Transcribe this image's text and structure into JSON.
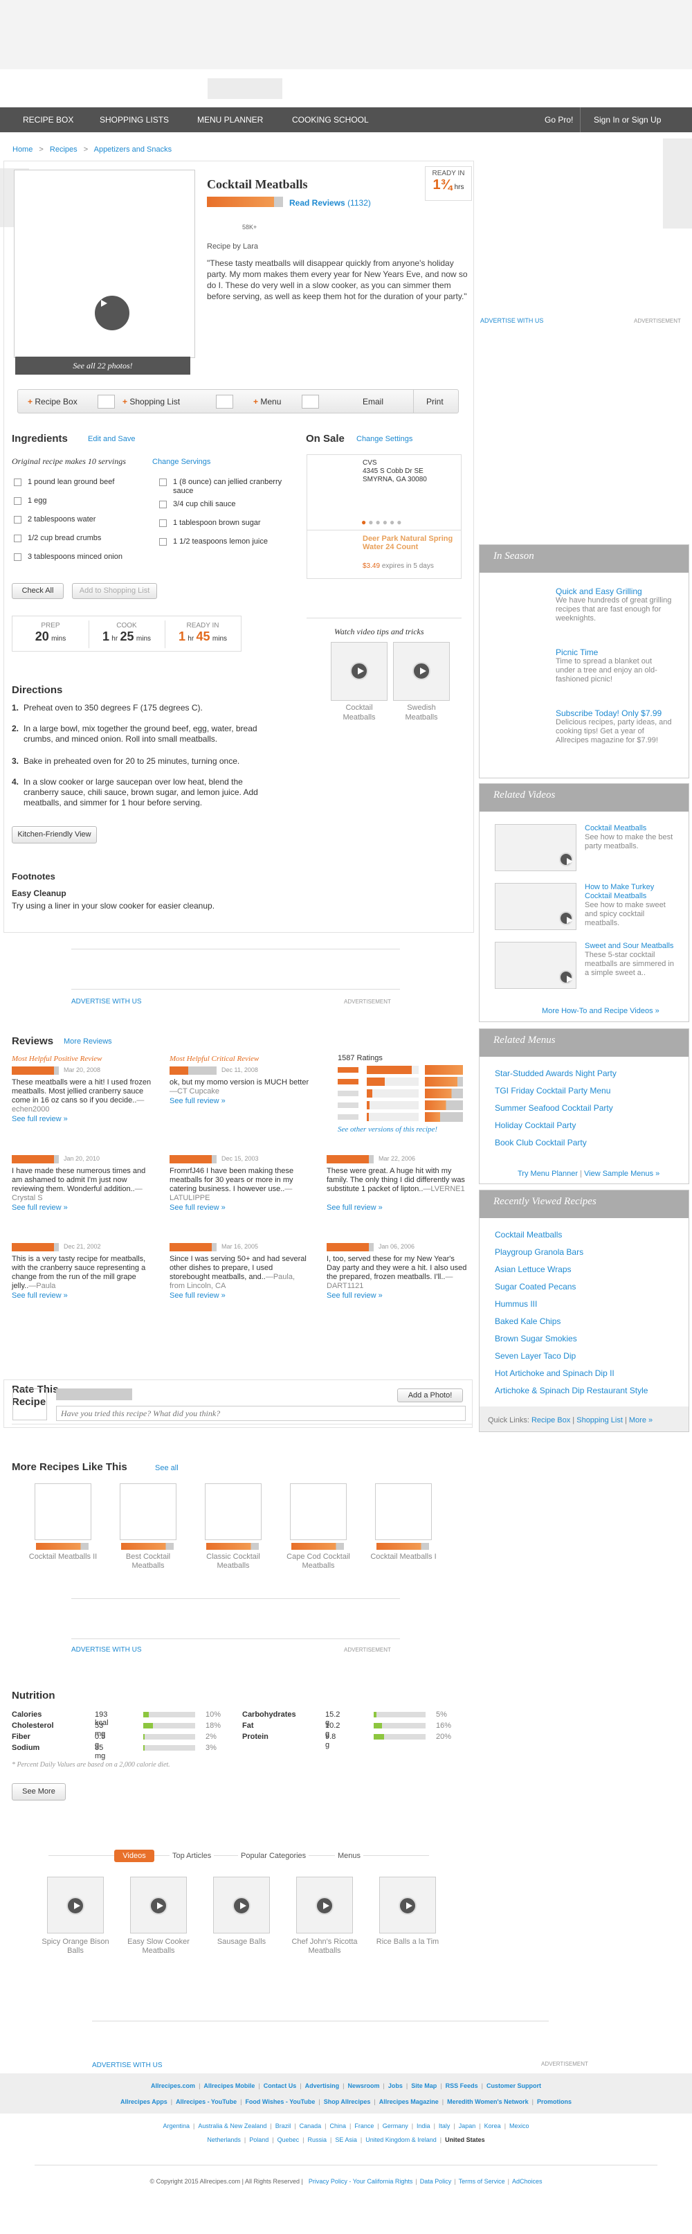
{
  "nav": {
    "items": [
      "RECIPE BOX",
      "SHOPPING LISTS",
      "MENU PLANNER",
      "COOKING SCHOOL"
    ],
    "gopro": "Go Pro!",
    "signin": "Sign In or Sign Up"
  },
  "breadcrumb": [
    "Home",
    "Recipes",
    "Appetizers and Snacks"
  ],
  "recipe": {
    "title": "Cocktail Meatballs",
    "ready_label": "READY IN",
    "ready_value": "1¾",
    "ready_unit": "hrs",
    "reviews_link": "Read Reviews",
    "reviews_count": "(1132)",
    "made_count": "58K+",
    "by": "Recipe by Lara",
    "description": "\"These tasty meatballs will disappear quickly from anyone's holiday party. My mom makes them every year for New Years Eve, and now so do I. These do very well in a slow cooker, as you can simmer them before serving, as well as keep them hot for the duration of your party.\"",
    "photos": "See all 22 photos!",
    "rating_fraction": 0.88
  },
  "actions": [
    "Recipe Box",
    "Shopping List",
    "Menu",
    "Email",
    "Print"
  ],
  "ingredients": {
    "title": "Ingredients",
    "edit": "Edit and Save",
    "servings": "Original recipe makes 10 servings",
    "change": "Change Servings",
    "left": [
      "1 pound lean ground beef",
      "1 egg",
      "2 tablespoons water",
      "1/2 cup bread crumbs",
      "3 tablespoons minced onion"
    ],
    "right": [
      "1 (8 ounce) can jellied cranberry sauce",
      "3/4 cup chili sauce",
      "1 tablespoon brown sugar",
      "1 1/2 teaspoons lemon juice"
    ],
    "check_all": "Check All",
    "add_shop": "Add to Shopping List"
  },
  "times": {
    "prep_label": "PREP",
    "prep": "20",
    "prep_unit": "mins",
    "cook_label": "COOK",
    "cook_h": "1",
    "cook_m": "25",
    "cook_unit_h": "hr",
    "cook_unit_m": "mins",
    "ready_label": "READY IN",
    "ready_h": "1",
    "ready_m": "45",
    "ready_unit_h": "hr",
    "ready_unit_m": "mins"
  },
  "onsale": {
    "title": "On Sale",
    "settings": "Change Settings",
    "store": "CVS",
    "address1": "4345 S Cobb Dr SE",
    "address2": "SMYRNA, GA 30080",
    "product": "Deer Park Natural Spring Water 24 Count",
    "price": "$3.49",
    "expires": "expires in 5 days"
  },
  "videos_tips": {
    "title": "Watch video tips and tricks",
    "items": [
      "Cocktail Meatballs",
      "Swedish Meatballs"
    ]
  },
  "directions": {
    "title": "Directions",
    "steps": [
      "Preheat oven to 350 degrees F (175 degrees C).",
      "In a large bowl, mix together the ground beef, egg, water, bread crumbs, and minced onion. Roll into small meatballs.",
      "Bake in preheated oven for 20 to 25 minutes, turning once.",
      "In a slow cooker or large saucepan over low heat, blend the cranberry sauce, chili sauce, brown sugar, and lemon juice. Add meatballs, and simmer for 1 hour before serving."
    ],
    "kitchen": "Kitchen-Friendly View"
  },
  "footnotes": {
    "title": "Footnotes",
    "sub": "Easy Cleanup",
    "text": "Try using a liner in your slow cooker for easier cleanup."
  },
  "ads": {
    "advertise": "ADVERTISE WITH US",
    "advertisement": "ADVERTISEMENT"
  },
  "reviews": {
    "title": "Reviews",
    "more": "More Reviews",
    "pos_label": "Most Helpful Positive Review",
    "crit_label": "Most Helpful Critical Review",
    "ratings_count": "1587 Ratings",
    "other_versions": "See other versions of this recipe!",
    "full": "See full review »",
    "rating_dist": [
      0.86,
      0.34,
      0.1,
      0.05,
      0.04
    ],
    "items": [
      {
        "date": "Mar 20, 2008",
        "text": "These meatballs were a hit! I used frozen meatballs. Most jellied cranberry sauce come in 16 oz cans so if you decide..",
        "author": "—echen2000",
        "stars": 0.9
      },
      {
        "date": "Dec 11, 2008",
        "text": "ok, but my momo version is MUCH better",
        "author": "—CT Cupcake",
        "stars": 0.4
      },
      {
        "date": "Jan 20, 2010",
        "text": "I have made these numerous times and am ashamed to admit I'm just now reviewing them. Wonderful addition..",
        "author": "—Crystal S",
        "stars": 0.9
      },
      {
        "date": "Dec 15, 2003",
        "text": "FromrfJ46 I have been making these meatballs for 30 years or more in my catering business. I however use..",
        "author": "—LATULIPPE",
        "stars": 0.9
      },
      {
        "date": "Mar 22, 2006",
        "text": "These were great. A huge hit with my family. The only thing I did differently was substitute 1 packet of lipton..",
        "author": "—LVERNE1",
        "stars": 0.9
      },
      {
        "date": "Dec 21, 2002",
        "text": "This is a very tasty recipe for meatballs, with the cranberry sauce representing a change from the run of the mill grape jelly..",
        "author": "—Paula",
        "stars": 0.9
      },
      {
        "date": "Mar 16, 2005",
        "text": "Since I was serving 50+ and had several other dishes to prepare, I used storebought meatballs, and..",
        "author": "—Paula, from Lincoln, CA",
        "stars": 0.9
      },
      {
        "date": "Jan 06, 2006",
        "text": "I, too, served these for my New Year's Day party and they were a hit. I also used the prepared, frozen meatballs. I'll..",
        "author": "—DART1121",
        "stars": 0.9
      }
    ]
  },
  "rate": {
    "title": "Rate This Recipe",
    "add_photo": "Add a Photo!",
    "placeholder": "Have you tried this recipe? What did you think?"
  },
  "more_recipes": {
    "title": "More Recipes Like This",
    "see_all": "See all",
    "items": [
      "Cocktail Meatballs II",
      "Best Cocktail Meatballs",
      "Classic Cocktail Meatballs",
      "Cape Cod Cocktail Meatballs",
      "Cocktail Meatballs I"
    ]
  },
  "nutrition": {
    "title": "Nutrition",
    "left": [
      {
        "name": "Calories",
        "amount": "193 kcal",
        "pct": "10%",
        "v": 0.1
      },
      {
        "name": "Cholesterol",
        "amount": "53 mg",
        "pct": "18%",
        "v": 0.18
      },
      {
        "name": "Fiber",
        "amount": "0.5 g",
        "pct": "2%",
        "v": 0.02
      },
      {
        "name": "Sodium",
        "amount": "85 mg",
        "pct": "3%",
        "v": 0.03
      }
    ],
    "right": [
      {
        "name": "Carbohydrates",
        "amount": "15.2 g",
        "pct": "5%",
        "v": 0.05
      },
      {
        "name": "Fat",
        "amount": "10.2 g",
        "pct": "16%",
        "v": 0.16
      },
      {
        "name": "Protein",
        "amount": "9.8 g",
        "pct": "20%",
        "v": 0.2
      }
    ],
    "note": "* Percent Daily Values are based on a 2,000 calorie diet.",
    "see_more": "See More"
  },
  "bottom_tabs": {
    "tabs": [
      "Videos",
      "Top Articles",
      "Popular Categories",
      "Menus"
    ],
    "videos": [
      "Spicy Orange Bison Balls",
      "Easy Slow Cooker Meatballs",
      "Sausage Balls",
      "Chef John's Ricotta Meatballs",
      "Rice Balls a la Tim"
    ]
  },
  "sidebar": {
    "in_season": {
      "title": "In Season",
      "items": [
        {
          "title": "Quick and Easy Grilling",
          "desc": "We have hundreds of great grilling recipes that are fast enough for weeknights."
        },
        {
          "title": "Picnic Time",
          "desc": "Time to spread a blanket out under a tree and enjoy an old-fashioned picnic!"
        },
        {
          "title": "Subscribe Today! Only $7.99",
          "desc": "Delicious recipes, party ideas, and cooking tips! Get a year of Allrecipes magazine for $7.99!"
        }
      ]
    },
    "related_videos": {
      "title": "Related Videos",
      "items": [
        {
          "title": "Cocktail Meatballs",
          "desc": "See how to make the best party meatballs."
        },
        {
          "title": "How to Make Turkey Cocktail Meatballs",
          "desc": "See how to make sweet and spicy cocktail meatballs."
        },
        {
          "title": "Sweet and Sour Meatballs",
          "desc": "These 5-star cocktail meatballs are simmered in a simple sweet a.."
        }
      ],
      "more": "More How-To and Recipe Videos »"
    },
    "related_menus": {
      "title": "Related Menus",
      "items": [
        "Star-Studded Awards Night Party",
        "TGI Friday Cocktail Party Menu",
        "Summer Seafood Cocktail Party",
        "Holiday Cocktail Party",
        "Book Club Cocktail Party"
      ],
      "try": "Try Menu Planner",
      "sample": "View Sample Menus »"
    },
    "recently_viewed": {
      "title": "Recently Viewed Recipes",
      "items": [
        "Cocktail Meatballs",
        "Playgroup Granola Bars",
        "Asian Lettuce Wraps",
        "Sugar Coated Pecans",
        "Hummus III",
        "Baked Kale Chips",
        "Brown Sugar Smokies",
        "Seven Layer Taco Dip",
        "Hot Artichoke and Spinach Dip II",
        "Artichoke & Spinach Dip Restaurant Style"
      ],
      "quick": "Quick Links:",
      "links": [
        "Recipe Box",
        "Shopping List",
        "More »"
      ]
    }
  },
  "footer": {
    "row1": [
      "Allrecipes.com",
      "Allrecipes Mobile",
      "Contact Us",
      "Advertising",
      "Newsroom",
      "Jobs",
      "Site Map",
      "RSS Feeds",
      "Customer Support"
    ],
    "row2": [
      "Allrecipes Apps",
      "Allrecipes - YouTube",
      "Food Wishes - YouTube",
      "Shop Allrecipes",
      "Allrecipes Magazine",
      "Meredith Women's Network",
      "Promotions"
    ],
    "countries1": [
      "Argentina",
      "Australia & New Zealand",
      "Brazil",
      "Canada",
      "China",
      "France",
      "Germany",
      "India",
      "Italy",
      "Japan",
      "Korea",
      "Mexico"
    ],
    "countries2": [
      "Netherlands",
      "Poland",
      "Quebec",
      "Russia",
      "SE Asia",
      "United Kingdom & Ireland",
      "United States"
    ],
    "copyright": "© Copyright 2015 Allrecipes.com | All Rights Reserved |",
    "legal": [
      "Privacy Policy - Your California Rights",
      "Data Policy",
      "Terms of Service",
      "AdChoices"
    ]
  }
}
